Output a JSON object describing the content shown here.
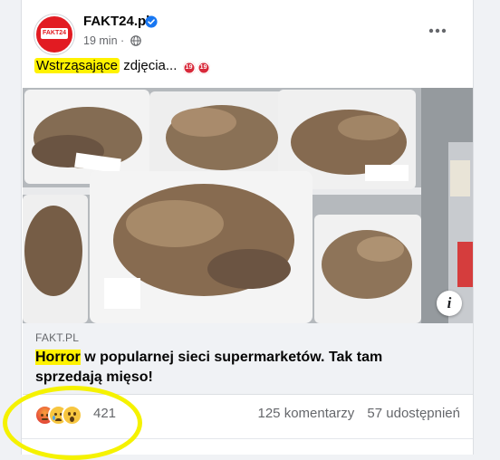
{
  "post": {
    "page_name": "FAKT24.pl",
    "logo_text": "FAKT24",
    "verified_icon": "verified-badge-icon",
    "time": "19 min",
    "separator": "·",
    "audience_icon": "globe-icon",
    "text_highlighted": "Wstrząsające",
    "text_rest": " zdjęcia...",
    "emoji_badges": [
      "19",
      "19"
    ],
    "more_icon": "more-horizontal-icon"
  },
  "link": {
    "domain": "FAKT.PL",
    "title_highlighted": "Horror",
    "title_rest": " w popularnej sieci supermarketów. Tak tam sprzedają mięso!",
    "info_icon": "info-icon",
    "info_glyph": "i"
  },
  "stats": {
    "reactions": [
      "angry",
      "sad",
      "wow"
    ],
    "reaction_count": "421",
    "comments": "125 komentarzy",
    "shares": "57 udostępnień"
  },
  "colors": {
    "highlight": "#fff200",
    "brand_red": "#e21b22",
    "verified_blue": "#1877f2",
    "secondary_text": "#65676b"
  }
}
